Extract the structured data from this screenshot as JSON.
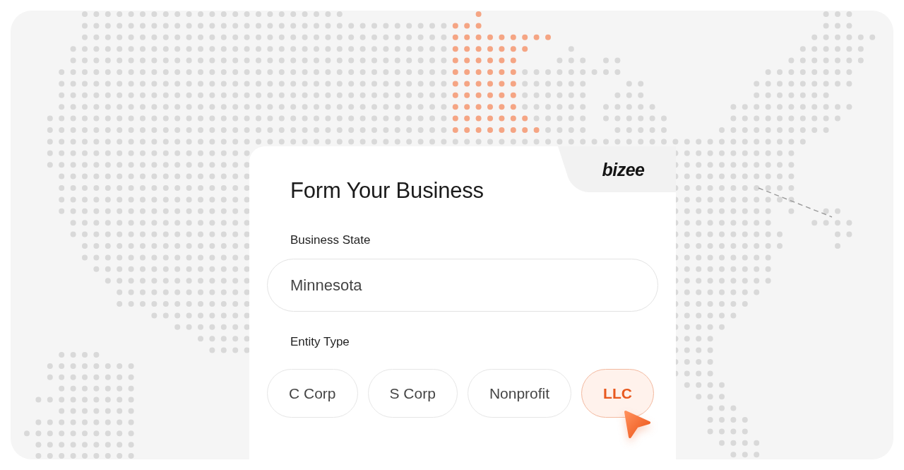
{
  "logo": "bizee",
  "title": "Form Your Business",
  "business_state": {
    "label": "Business State",
    "value": "Minnesota"
  },
  "entity_type": {
    "label": "Entity Type",
    "options": [
      {
        "label": "C Corp",
        "selected": false
      },
      {
        "label": "S Corp",
        "selected": false
      },
      {
        "label": "Nonprofit",
        "selected": false
      },
      {
        "label": "LLC",
        "selected": true
      }
    ]
  }
}
